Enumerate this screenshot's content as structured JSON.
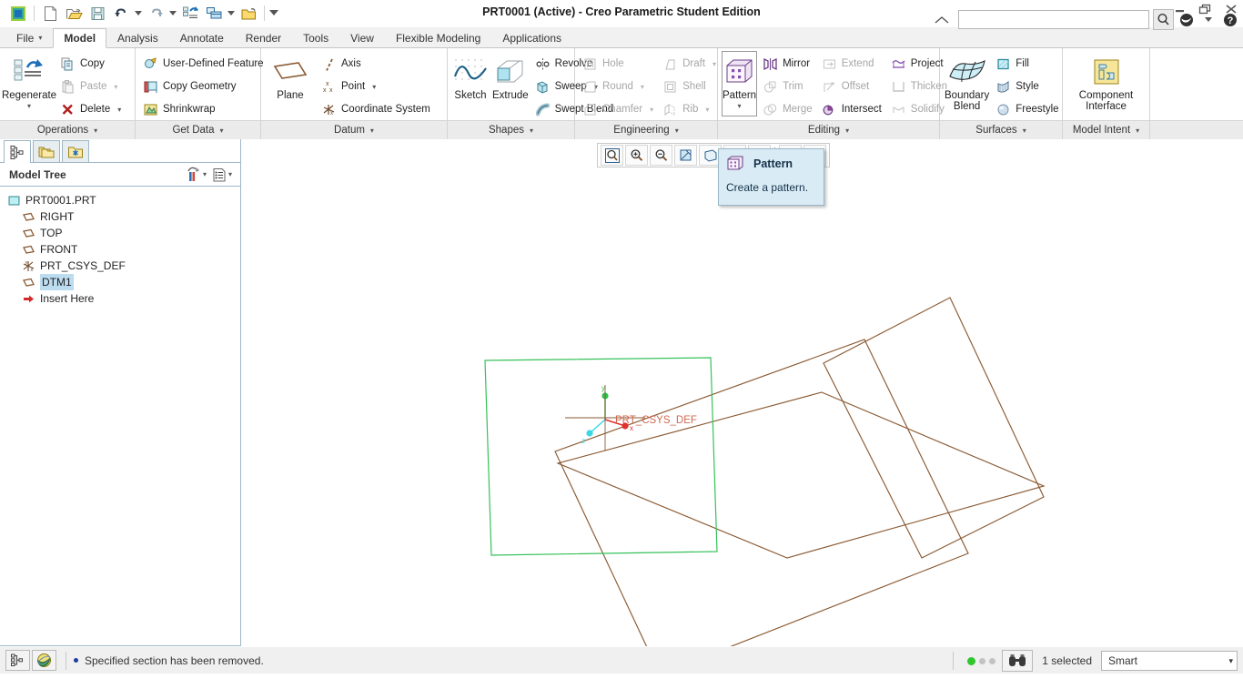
{
  "window": {
    "title": "PRT0001 (Active) - Creo Parametric Student Edition",
    "minimize": "–",
    "restore": "❐",
    "close": "✕"
  },
  "quick_access": {
    "items": [
      {
        "name": "creo-app-icon",
        "label": "Creo"
      },
      {
        "name": "new-icon",
        "label": "New"
      },
      {
        "name": "open-icon",
        "label": "Open"
      },
      {
        "name": "save-icon",
        "label": "Save"
      },
      {
        "name": "undo-icon",
        "label": "Undo"
      },
      {
        "name": "redo-icon",
        "label": "Redo"
      },
      {
        "name": "regenerate-icon",
        "label": "Regenerate"
      },
      {
        "name": "window-switch-icon",
        "label": "Switch Window"
      },
      {
        "name": "close-window-icon",
        "label": "Close Window"
      },
      {
        "name": "customize-qat-icon",
        "label": "Customize Quick Access Toolbar"
      }
    ],
    "caret": "▾"
  },
  "tabs": [
    {
      "label": "File",
      "caret": "▾",
      "active": false
    },
    {
      "label": "Model",
      "active": true
    },
    {
      "label": "Analysis",
      "active": false
    },
    {
      "label": "Annotate",
      "active": false
    },
    {
      "label": "Render",
      "active": false
    },
    {
      "label": "Tools",
      "active": false
    },
    {
      "label": "View",
      "active": false
    },
    {
      "label": "Flexible Modeling",
      "active": false
    },
    {
      "label": "Applications",
      "active": false
    }
  ],
  "search": {
    "value": "",
    "placeholder": "",
    "collapse_icon": "collapse-ribbon-icon",
    "search_icon": "search-icon",
    "help_icon": "help-icon",
    "globe_icon": "globe-icon",
    "globe_caret": "▾"
  },
  "ribbon": {
    "groups": [
      {
        "title": "Operations",
        "caret": "▾",
        "big": [
          {
            "label": "Regenerate",
            "icon": "regenerate-icon",
            "caret": "▾",
            "disabled": false
          }
        ],
        "columns": [
          [
            {
              "label": "Copy",
              "icon": "copy-icon",
              "disabled": false,
              "caret": ""
            },
            {
              "label": "Paste",
              "icon": "paste-icon",
              "disabled": true,
              "caret": "▾"
            },
            {
              "label": "Delete",
              "icon": "delete-icon",
              "disabled": false,
              "caret": "▾"
            }
          ]
        ]
      },
      {
        "title": "Get Data",
        "caret": "▾",
        "big": [],
        "columns": [
          [
            {
              "label": "User-Defined Feature",
              "icon": "udf-icon",
              "disabled": false,
              "caret": ""
            },
            {
              "label": "Copy Geometry",
              "icon": "copy-geometry-icon",
              "disabled": false,
              "caret": ""
            },
            {
              "label": "Shrinkwrap",
              "icon": "shrinkwrap-icon",
              "disabled": false,
              "caret": ""
            }
          ]
        ]
      },
      {
        "title": "Datum",
        "caret": "▾",
        "big": [
          {
            "label": "Plane",
            "icon": "datum-plane-icon",
            "caret": "",
            "disabled": false
          }
        ],
        "columns": [
          [
            {
              "label": "Axis",
              "icon": "datum-axis-icon",
              "disabled": false,
              "caret": ""
            },
            {
              "label": "Point",
              "icon": "datum-point-icon",
              "disabled": false,
              "caret": "▾"
            },
            {
              "label": "Coordinate System",
              "icon": "csys-icon",
              "disabled": false,
              "caret": ""
            }
          ]
        ]
      },
      {
        "title": "Shapes",
        "caret": "▾",
        "big": [
          {
            "label": "Sketch",
            "icon": "sketch-icon",
            "caret": "",
            "disabled": false
          },
          {
            "label": "Extrude",
            "icon": "extrude-icon",
            "caret": "",
            "disabled": false
          }
        ],
        "columns": [
          [
            {
              "label": "Revolve",
              "icon": "revolve-icon",
              "disabled": false,
              "caret": ""
            },
            {
              "label": "Sweep",
              "icon": "sweep-icon",
              "disabled": false,
              "caret": "▾"
            },
            {
              "label": "Swept Blend",
              "icon": "swept-blend-icon",
              "disabled": false,
              "caret": ""
            }
          ]
        ]
      },
      {
        "title": "Engineering",
        "caret": "▾",
        "big": [],
        "columns": [
          [
            {
              "label": "Hole",
              "icon": "hole-icon",
              "disabled": true,
              "caret": ""
            },
            {
              "label": "Round",
              "icon": "round-icon",
              "disabled": true,
              "caret": "▾"
            },
            {
              "label": "Chamfer",
              "icon": "chamfer-icon",
              "disabled": true,
              "caret": "▾"
            }
          ],
          [
            {
              "label": "Draft",
              "icon": "draft-icon",
              "disabled": true,
              "caret": "▾"
            },
            {
              "label": "Shell",
              "icon": "shell-icon",
              "disabled": true,
              "caret": ""
            },
            {
              "label": "Rib",
              "icon": "rib-icon",
              "disabled": true,
              "caret": "▾"
            }
          ]
        ]
      },
      {
        "title": "Editing",
        "caret": "▾",
        "big": [
          {
            "label": "Pattern",
            "icon": "pattern-icon",
            "caret": "▾",
            "disabled": false,
            "hovered": true
          }
        ],
        "columns": [
          [
            {
              "label": "Mirror",
              "icon": "mirror-icon",
              "disabled": false,
              "caret": ""
            },
            {
              "label": "Trim",
              "icon": "trim-icon",
              "disabled": true,
              "caret": ""
            },
            {
              "label": "Merge",
              "icon": "merge-icon",
              "disabled": true,
              "caret": ""
            }
          ],
          [
            {
              "label": "Extend",
              "icon": "extend-icon",
              "disabled": true,
              "caret": ""
            },
            {
              "label": "Offset",
              "icon": "offset-icon",
              "disabled": true,
              "caret": ""
            },
            {
              "label": "Intersect",
              "icon": "intersect-icon",
              "disabled": false,
              "caret": ""
            }
          ],
          [
            {
              "label": "Project",
              "icon": "project-icon",
              "disabled": false,
              "caret": ""
            },
            {
              "label": "Thicken",
              "icon": "thicken-icon",
              "disabled": true,
              "caret": ""
            },
            {
              "label": "Solidify",
              "icon": "solidify-icon",
              "disabled": true,
              "caret": ""
            }
          ]
        ]
      },
      {
        "title": "Surfaces",
        "caret": "▾",
        "big": [
          {
            "label": "Boundary\nBlend",
            "icon": "boundary-blend-icon",
            "caret": "",
            "disabled": false
          }
        ],
        "columns": [
          [
            {
              "label": "Fill",
              "icon": "fill-icon",
              "disabled": false,
              "caret": ""
            },
            {
              "label": "Style",
              "icon": "style-icon",
              "disabled": false,
              "caret": ""
            },
            {
              "label": "Freestyle",
              "icon": "freestyle-icon",
              "disabled": false,
              "caret": ""
            }
          ]
        ]
      },
      {
        "title": "Model Intent",
        "caret": "▾",
        "big": [
          {
            "label": "Component\nInterface",
            "icon": "component-interface-icon",
            "caret": "",
            "disabled": false
          }
        ],
        "columns": []
      }
    ]
  },
  "nav": {
    "tabs": [
      {
        "name": "model-tree-tab",
        "icon": "model-tree-icon",
        "active": true
      },
      {
        "name": "folder-browser-tab",
        "icon": "folders-icon",
        "active": false
      },
      {
        "name": "favorites-tab",
        "icon": "favorites-folder-icon",
        "active": false
      }
    ],
    "tree_title": "Model Tree",
    "header_buttons": [
      {
        "name": "tree-filters-button",
        "icon": "tools-filter-icon",
        "caret": "▾"
      },
      {
        "name": "tree-settings-button",
        "icon": "tree-settings-icon",
        "caret": "▾"
      }
    ],
    "tree": [
      {
        "label": "PRT0001.PRT",
        "icon": "part-icon",
        "indent": 0,
        "selected": false
      },
      {
        "label": "RIGHT",
        "icon": "datum-plane-small-icon",
        "indent": 1,
        "selected": false
      },
      {
        "label": "TOP",
        "icon": "datum-plane-small-icon",
        "indent": 1,
        "selected": false
      },
      {
        "label": "FRONT",
        "icon": "datum-plane-small-icon",
        "indent": 1,
        "selected": false
      },
      {
        "label": "PRT_CSYS_DEF",
        "icon": "csys-small-icon",
        "indent": 1,
        "selected": false
      },
      {
        "label": "DTM1",
        "icon": "datum-plane-small-icon",
        "indent": 1,
        "selected": true
      },
      {
        "label": "Insert Here",
        "icon": "insert-here-icon",
        "indent": 1,
        "selected": false
      }
    ]
  },
  "graphics_toolbar": {
    "buttons": [
      {
        "name": "refit-button",
        "icon": "refit-icon"
      },
      {
        "name": "zoom-in-button",
        "icon": "zoom-in-icon"
      },
      {
        "name": "zoom-out-button",
        "icon": "zoom-out-icon"
      },
      {
        "name": "repaint-button",
        "icon": "repaint-icon"
      },
      {
        "name": "display-style-button",
        "icon": "display-style-icon"
      },
      {
        "name": "saved-orientations-button",
        "icon": "saved-orientations-icon"
      },
      {
        "name": "datum-display-button",
        "icon": "datum-display-icon"
      },
      {
        "name": "annotation-display-button",
        "icon": "annotation-display-icon"
      },
      {
        "name": "spin-center-button",
        "icon": "spin-center-icon"
      }
    ]
  },
  "tooltip": {
    "title": "Pattern",
    "description": "Create a pattern.",
    "icon": "pattern-icon"
  },
  "viewport": {
    "csys_label": "PRT_CSYS_DEF",
    "axis_labels": {
      "x": "x",
      "y": "y",
      "z": "z"
    },
    "colors": {
      "datum_plane": "#8a5a33",
      "selected_plane": "#36c15a",
      "axis_x": "#e03030",
      "axis_y": "#2fc24e",
      "axis_z": "#3ad7e8",
      "csys_label": "#d06a50"
    }
  },
  "statusbar": {
    "buttons": [
      {
        "name": "navigator-toggle-button",
        "icon": "model-tree-icon"
      },
      {
        "name": "web-browser-toggle-button",
        "icon": "browser-icon"
      }
    ],
    "message": "Specified section has been removed.",
    "leds": [
      {
        "name": "led-active",
        "color": "#2fc62f"
      },
      {
        "name": "led-idle-1",
        "color": "#c2c2c2"
      },
      {
        "name": "led-idle-2",
        "color": "#c2c2c2"
      }
    ],
    "search_tool": {
      "name": "find-button",
      "icon": "binoculars-icon"
    },
    "selection_count": "1 selected",
    "filter": {
      "value": "Smart",
      "caret": "▾"
    }
  }
}
